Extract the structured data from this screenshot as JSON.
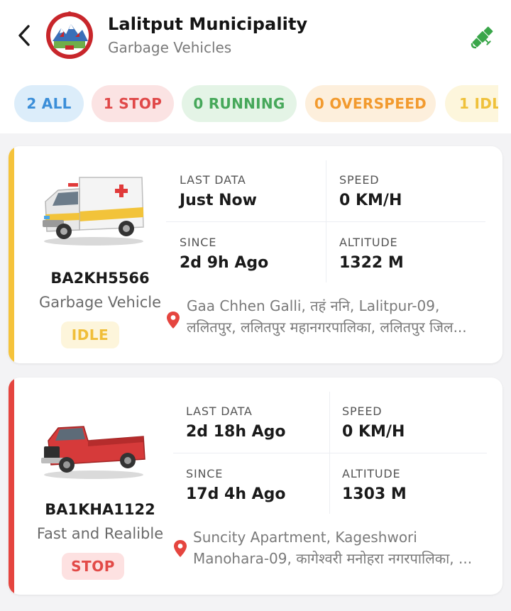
{
  "header": {
    "title": "Lalitput Municipality",
    "subtitle": "Garbage Vehicles",
    "back_icon": "chevron-left-icon",
    "action_icon": "satellite-icon",
    "action_color": "#3aa64a"
  },
  "filters": [
    {
      "label": "2 ALL",
      "color": "#3b8ed8"
    },
    {
      "label": "1 STOP",
      "color": "#e04848"
    },
    {
      "label": "0 RUNNING",
      "color": "#46a85a"
    },
    {
      "label": "0 OVERSPEED",
      "color": "#f29a2e"
    },
    {
      "label": "1 IDL",
      "color": "#efc13a"
    }
  ],
  "vehicles": [
    {
      "plate": "BA2KH5566",
      "type": "Garbage Vehicle",
      "status": "IDLE",
      "status_color": "#f5c33b",
      "last_data_label": "LAST DATA",
      "last_data": "Just Now",
      "speed_label": "SPEED",
      "speed": "0 KM/H",
      "since_label": "SINCE",
      "since": "2d 9h Ago",
      "altitude_label": "ALTITUDE",
      "altitude": "1322 M",
      "address_line1": "Gaa Chhen Galli, तहं ननि, Lalitpur-09,",
      "address_line2": "ललितपुर, ललितपुर महानगरपालिका, ललितपुर जिल...",
      "image_icon": "ambulance-icon"
    },
    {
      "plate": "BA1KHA1122",
      "type": "Fast and Realible",
      "status": "STOP",
      "status_color": "#e5453f",
      "last_data_label": "LAST DATA",
      "last_data": "2d 18h Ago",
      "speed_label": "SPEED",
      "speed": "0 KM/H",
      "since_label": "SINCE",
      "since": "17d 4h Ago",
      "altitude_label": "ALTITUDE",
      "altitude": "1303 M",
      "address_line1": "Suncity Apartment, Kageshwori",
      "address_line2": "Manohara-09, कागेश्वरी मनोहरा नगरपालिका, ...",
      "image_icon": "pickup-truck-icon"
    }
  ]
}
